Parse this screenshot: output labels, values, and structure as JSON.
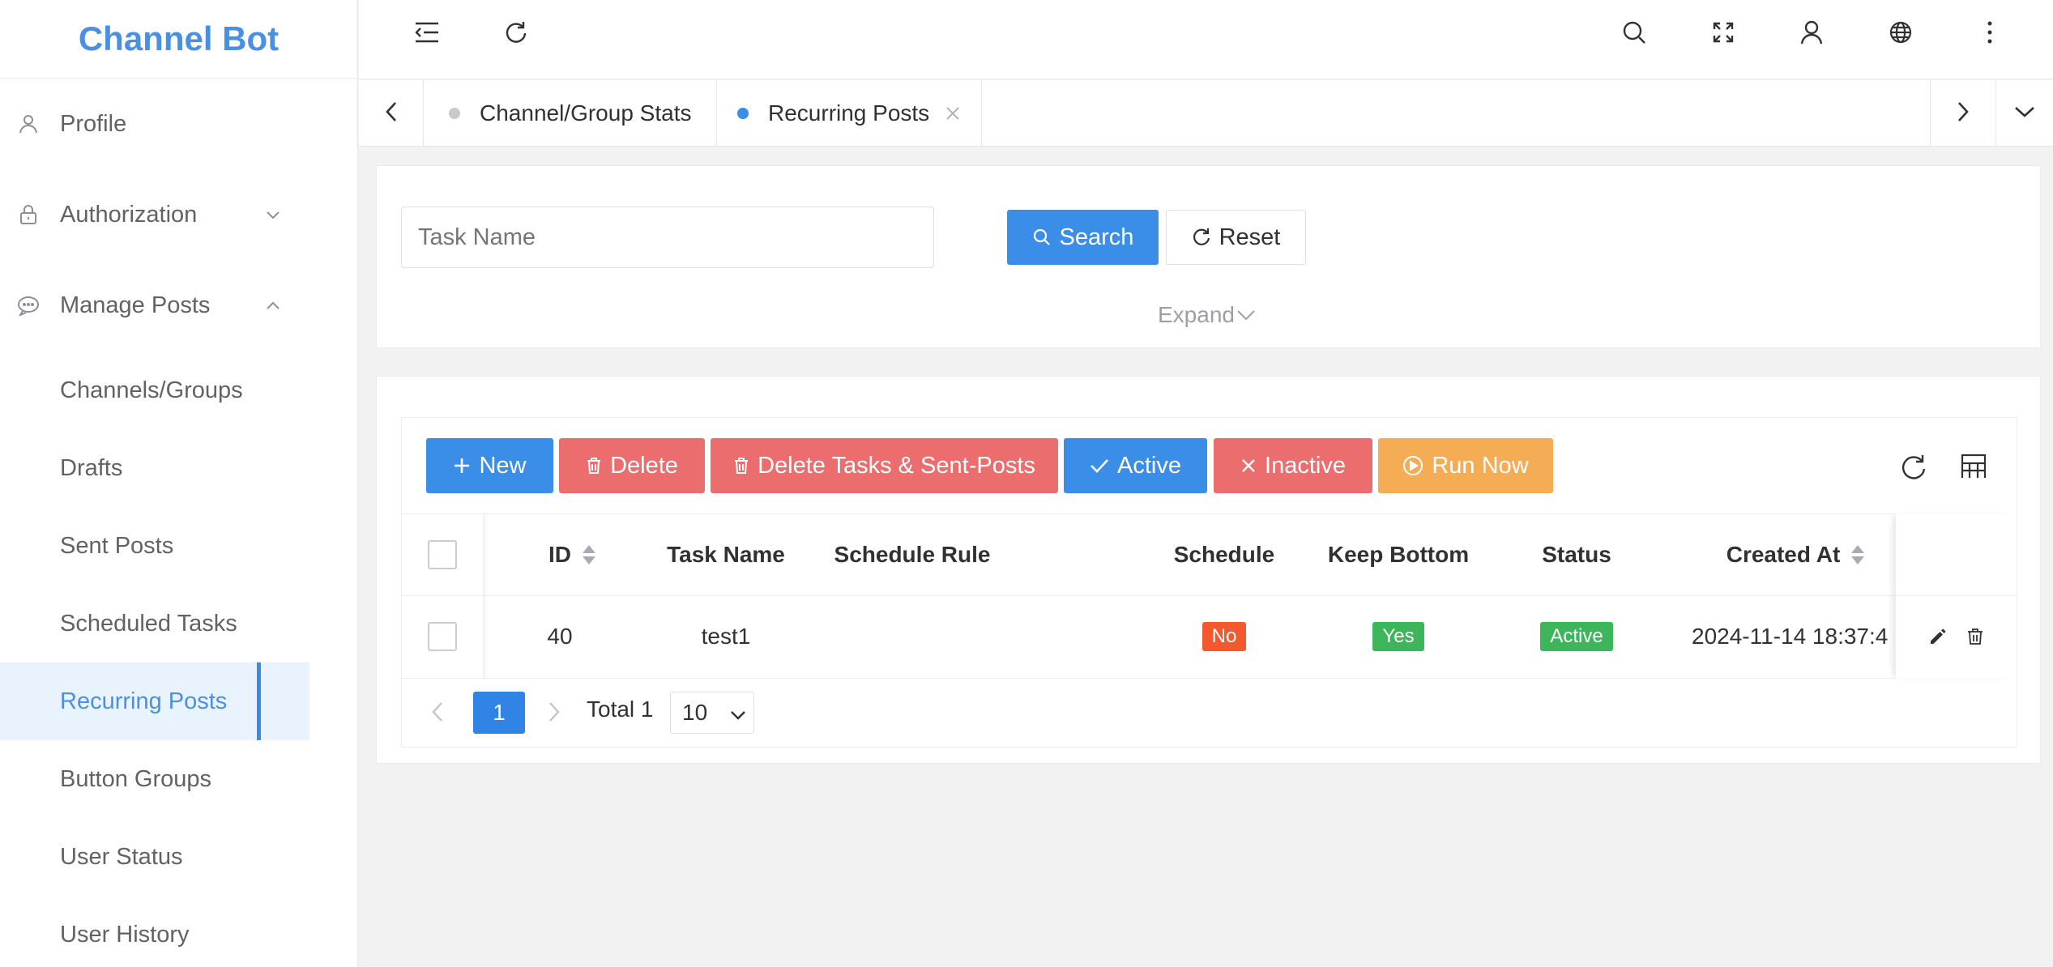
{
  "app": {
    "title": "Channel Bot"
  },
  "sidebar": {
    "items": [
      {
        "label": "Profile",
        "icon": "user-icon"
      },
      {
        "label": "Authorization",
        "icon": "lock-icon"
      },
      {
        "label": "Manage Posts",
        "icon": "chat-icon"
      },
      {
        "label": "Channels/Groups"
      },
      {
        "label": "Drafts"
      },
      {
        "label": "Sent Posts"
      },
      {
        "label": "Scheduled Tasks"
      },
      {
        "label": "Recurring Posts",
        "active": true
      },
      {
        "label": "Button Groups"
      },
      {
        "label": "User Status"
      },
      {
        "label": "User History"
      }
    ]
  },
  "tabs": [
    {
      "label": "Channel/Group Stats",
      "active": false
    },
    {
      "label": "Recurring Posts",
      "active": true
    }
  ],
  "search": {
    "placeholder": "Task Name",
    "search_label": "Search",
    "reset_label": "Reset",
    "expand_label": "Expand"
  },
  "toolbar": {
    "new_label": "New",
    "delete_label": "Delete",
    "delete_all_label": "Delete Tasks & Sent-Posts",
    "active_label": "Active",
    "inactive_label": "Inactive",
    "run_now_label": "Run Now"
  },
  "table": {
    "columns": [
      "ID",
      "Task Name",
      "Schedule Rule",
      "Schedule",
      "Keep Bottom",
      "Status",
      "Created At"
    ],
    "rows": [
      {
        "id": "40",
        "task_name": "test1",
        "schedule_rule": "",
        "schedule": "No",
        "keep_bottom": "Yes",
        "status": "Active",
        "created_at": "2024-11-14 18:37:4"
      }
    ]
  },
  "pagination": {
    "current_page": "1",
    "total_label": "Total 1",
    "page_size": "10"
  },
  "colors": {
    "primary": "#3b8ee8",
    "danger": "#ec6d6d",
    "warning": "#f4ac55",
    "success": "#3cb55b",
    "tag_no": "#f4582f",
    "brand": "#4a90e2"
  }
}
